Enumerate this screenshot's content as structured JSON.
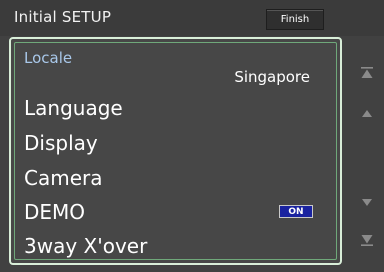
{
  "header": {
    "title": "Initial SETUP",
    "finish_label": "Finish"
  },
  "locale": {
    "label": "Locale",
    "value": "Singapore"
  },
  "items": [
    {
      "label": "Language"
    },
    {
      "label": "Display"
    },
    {
      "label": "Camera"
    },
    {
      "label": "DEMO",
      "toggle": "ON"
    },
    {
      "label": "3way X'over"
    }
  ],
  "colors": {
    "background": "#414141",
    "list_border": "#d8eed8",
    "locale_label": "#a9c8ea",
    "toggle_on": "#1a23a0"
  },
  "scrollbar": {
    "icons": [
      "scroll-top-icon",
      "scroll-up-icon",
      "scroll-down-icon",
      "scroll-bottom-icon"
    ]
  }
}
